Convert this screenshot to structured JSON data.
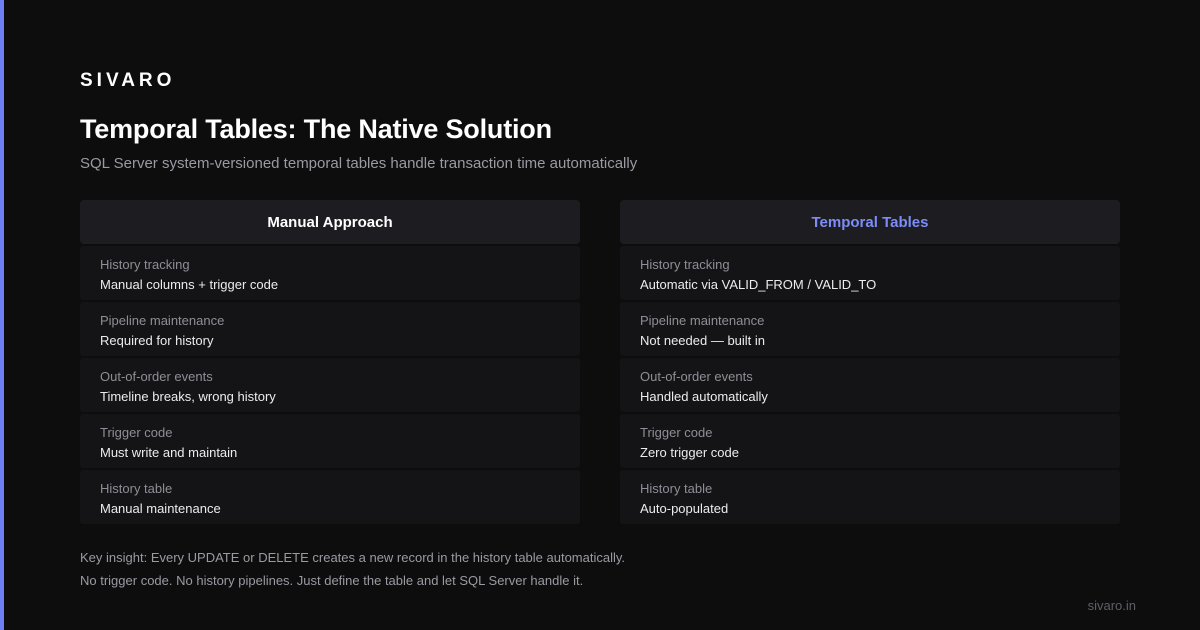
{
  "brand": "SIVARO",
  "title": "Temporal Tables: The Native Solution",
  "subtitle": "SQL Server system-versioned temporal tables handle transaction time automatically",
  "accent_color": "#6f7ef5",
  "columns": [
    {
      "header": "Manual Approach",
      "rows": [
        {
          "label": "History tracking",
          "value": "Manual columns + trigger code"
        },
        {
          "label": "Pipeline maintenance",
          "value": "Required for history"
        },
        {
          "label": "Out-of-order events",
          "value": "Timeline breaks, wrong history"
        },
        {
          "label": "Trigger code",
          "value": "Must write and maintain"
        },
        {
          "label": "History table",
          "value": "Manual maintenance"
        }
      ]
    },
    {
      "header": "Temporal Tables",
      "rows": [
        {
          "label": "History tracking",
          "value": "Automatic via VALID_FROM / VALID_TO"
        },
        {
          "label": "Pipeline maintenance",
          "value": "Not needed — built in"
        },
        {
          "label": "Out-of-order events",
          "value": "Handled automatically"
        },
        {
          "label": "Trigger code",
          "value": "Zero trigger code"
        },
        {
          "label": "History table",
          "value": "Auto-populated"
        }
      ]
    }
  ],
  "insight": {
    "line1": "Key insight: Every UPDATE or DELETE creates a new record in the history table automatically.",
    "line2": "No trigger code. No history pipelines. Just define the table and let SQL Server handle it."
  },
  "footer": "sivaro.in"
}
